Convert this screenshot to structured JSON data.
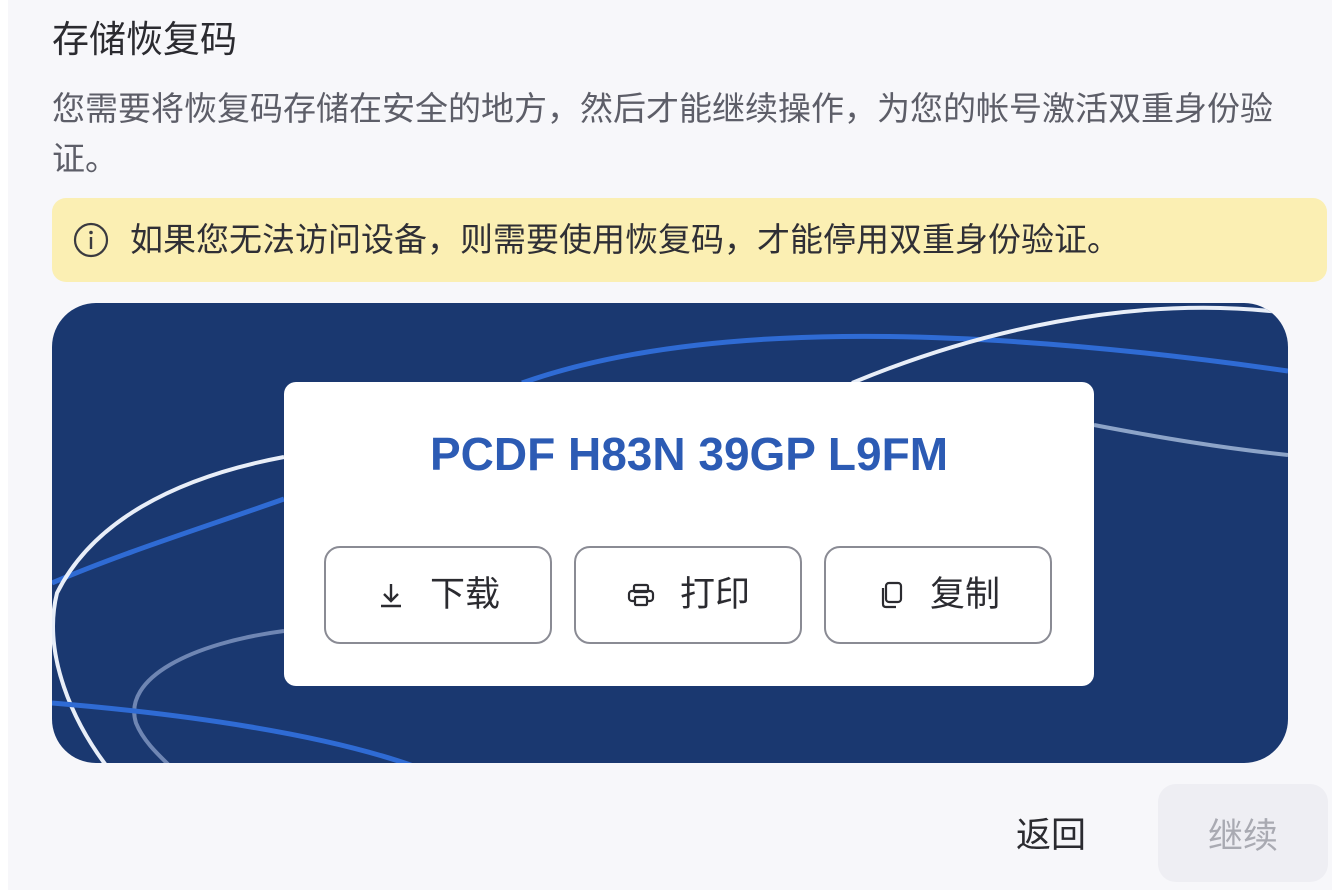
{
  "dialog": {
    "title": "存储恢复码",
    "description": "您需要将恢复码存储在安全的地方，然后才能继续操作，为您的帐号激活双重身份验证。"
  },
  "banner": {
    "icon": "info-icon",
    "text": "如果您无法访问设备，则需要使用恢复码，才能停用双重身份验证。",
    "background": "#fbefb3"
  },
  "recovery": {
    "code": "PCDF H83N 39GP L9FM",
    "code_color": "#2c5bb4",
    "background": "#1a3870",
    "actions": [
      {
        "label": "下载",
        "icon": "download-icon"
      },
      {
        "label": "打印",
        "icon": "printer-icon"
      },
      {
        "label": "复制",
        "icon": "copy-icon"
      }
    ]
  },
  "footer": {
    "back_label": "返回",
    "continue_label": "继续",
    "continue_disabled": true
  }
}
